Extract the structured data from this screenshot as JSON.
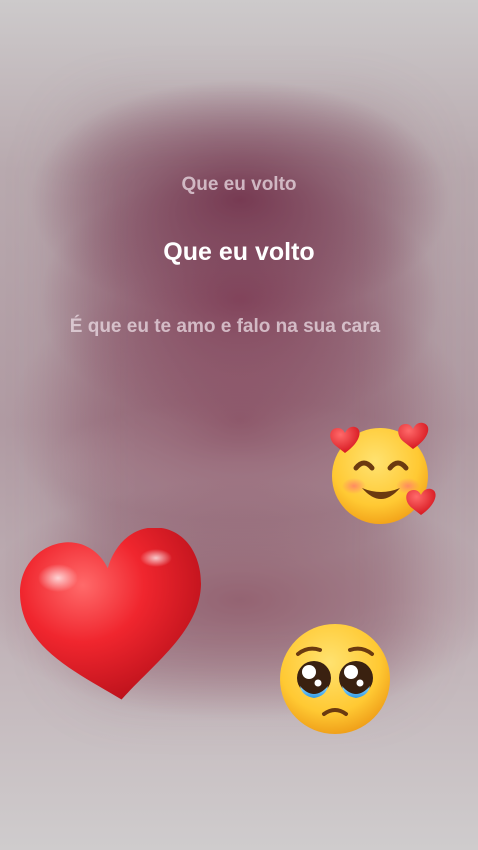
{
  "lyrics": {
    "previous_line": "Que eu volto",
    "current_line": "Que eu volto",
    "next_line": "É que eu te amo e falo na sua cara"
  },
  "stickers": [
    {
      "name": "red-heart-icon"
    },
    {
      "name": "smiling-face-with-hearts-icon"
    },
    {
      "name": "pleading-face-icon"
    }
  ],
  "colors": {
    "current_line": "#ffffff",
    "other_lines": "#ebdce4",
    "heart": "#e8232c",
    "emoji_face": "#ffcc33"
  }
}
